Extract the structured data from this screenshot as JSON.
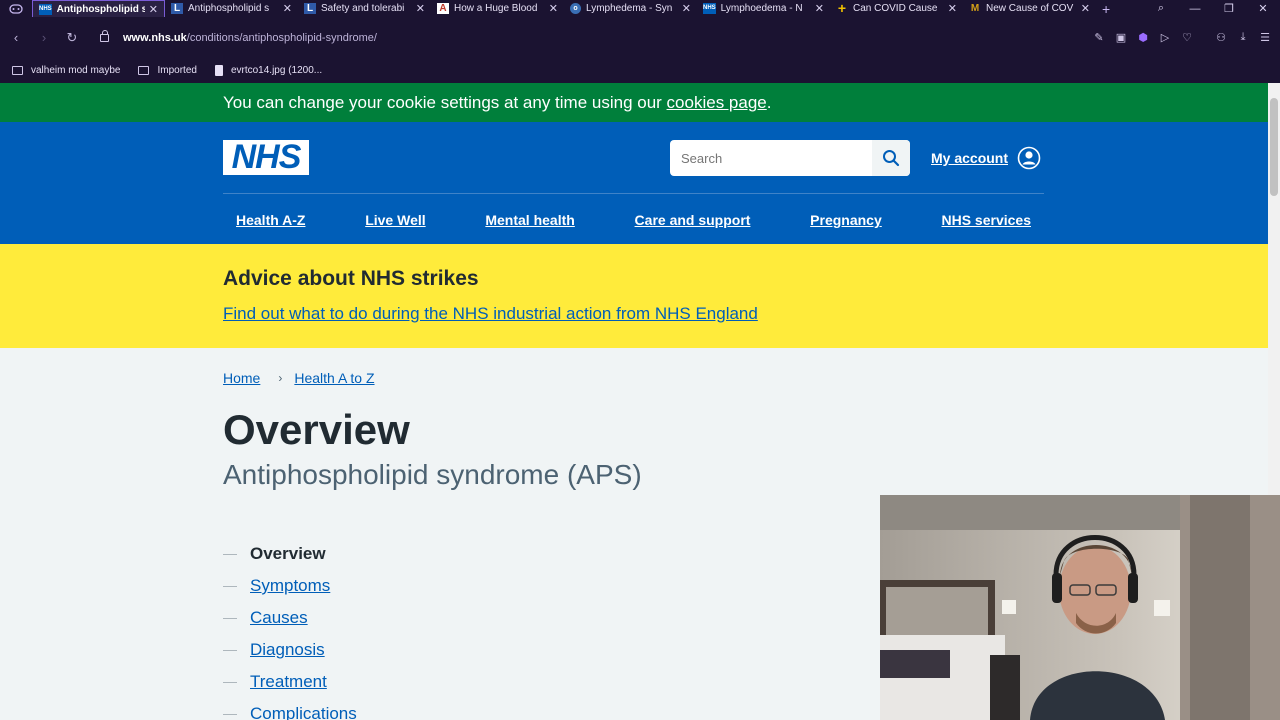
{
  "browser": {
    "tabs": [
      {
        "title": "Antiphospholipid s",
        "favicon": "NHS",
        "fav_color": "#005eb8",
        "active": true
      },
      {
        "title": "Antiphospholipid s",
        "favicon": "L",
        "fav_color": "#2f5aa8",
        "active": false
      },
      {
        "title": "Safety and tolerabi",
        "favicon": "L",
        "fav_color": "#2f5aa8",
        "active": false
      },
      {
        "title": "How a Huge Blood",
        "favicon": "A",
        "fav_color": "#c0392b",
        "active": false
      },
      {
        "title": "Lymphedema - Syn",
        "favicon": "o",
        "fav_color": "#3a6fb5",
        "active": false
      },
      {
        "title": "Lymphoedema - N",
        "favicon": "NHS",
        "fav_color": "#005eb8",
        "active": false
      },
      {
        "title": "Can COVID Cause",
        "favicon": "+",
        "fav_color": "#f2c200",
        "active": false
      },
      {
        "title": "New Cause of COV",
        "favicon": "M",
        "fav_color": "#d4a017",
        "active": false
      }
    ],
    "url_host": "www.nhs.uk",
    "url_path": "/conditions/antiphospholipid-syndrome/",
    "bookmarks": [
      {
        "label": "valheim mod maybe",
        "icon": "folder-icon"
      },
      {
        "label": "Imported",
        "icon": "folder-icon"
      },
      {
        "label": "evrtco14.jpg (1200...",
        "icon": "file-icon"
      }
    ]
  },
  "cookie_banner": {
    "text": "You can change your cookie settings at any time using our ",
    "link": "cookies page",
    "suffix": "."
  },
  "header": {
    "logo": "NHS",
    "search_placeholder": "Search",
    "account_label": "My account",
    "nav": [
      "Health A-Z",
      "Live Well",
      "Mental health",
      "Care and support",
      "Pregnancy",
      "NHS services"
    ]
  },
  "strike_banner": {
    "heading": "Advice about NHS strikes",
    "link": "Find out what to do during the NHS industrial action from NHS England"
  },
  "breadcrumb": [
    "Home",
    "Health A to Z"
  ],
  "page": {
    "title": "Overview",
    "subtitle": "Antiphospholipid syndrome (APS)"
  },
  "contents": [
    {
      "label": "Overview",
      "current": true
    },
    {
      "label": "Symptoms",
      "current": false
    },
    {
      "label": "Causes",
      "current": false
    },
    {
      "label": "Diagnosis",
      "current": false
    },
    {
      "label": "Treatment",
      "current": false
    },
    {
      "label": "Complications",
      "current": false
    }
  ],
  "colors": {
    "nhs_blue": "#005eb8",
    "nhs_green": "#007f3b",
    "warning_yellow": "#ffeb3b",
    "browser_bg": "#1b1331"
  }
}
